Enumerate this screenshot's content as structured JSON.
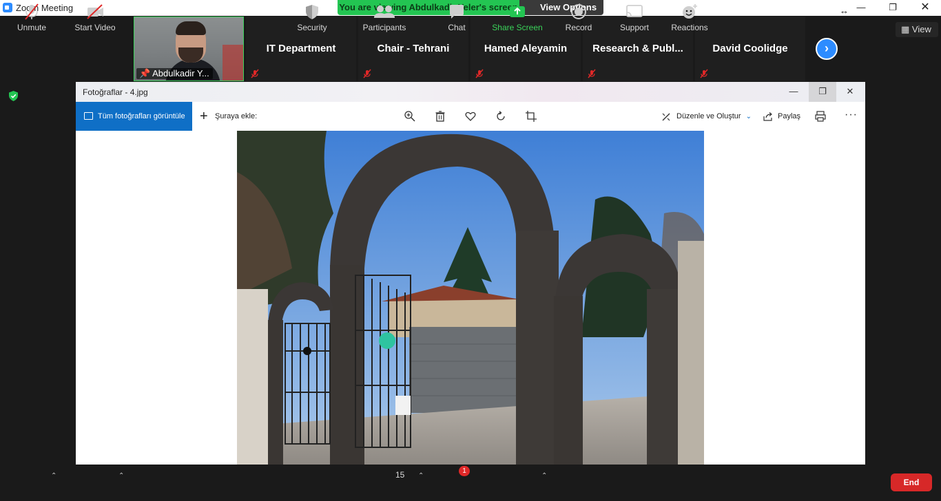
{
  "app": {
    "title": "Zoom Meeting"
  },
  "banner": {
    "viewing_text": "You are viewing Abdulkadir Yeler's screen",
    "view_options_label": "View Options"
  },
  "top_right": {
    "view_label": "View"
  },
  "participants": {
    "self_label": "Abdulkadir Y...",
    "tiles": [
      {
        "name": "IT Department"
      },
      {
        "name": "Chair - Tehrani"
      },
      {
        "name": "Hamed Aleyamin"
      },
      {
        "name": "Research & Publ..."
      },
      {
        "name": "David Coolidge"
      }
    ]
  },
  "photos_app": {
    "title": "Fotoğraflar - 4.jpg",
    "all_photos_label": "Tüm fotoğrafları görüntüle",
    "add_to_label": "Şuraya ekle:",
    "edit_create_label": "Düzenle ve Oluştur",
    "share_label": "Paylaş",
    "more_label": "···"
  },
  "controls": {
    "unmute": "Unmute",
    "start_video": "Start Video",
    "security": "Security",
    "participants": "Participants",
    "participants_count": "15",
    "chat": "Chat",
    "chat_badge": "1",
    "share_screen": "Share Screen",
    "record": "Record",
    "support": "Support",
    "reactions": "Reactions",
    "end": "End"
  },
  "colors": {
    "zoom_blue": "#2d8cff",
    "share_green": "#23c552",
    "end_red": "#d72828",
    "photos_accent": "#0f6fc6"
  }
}
